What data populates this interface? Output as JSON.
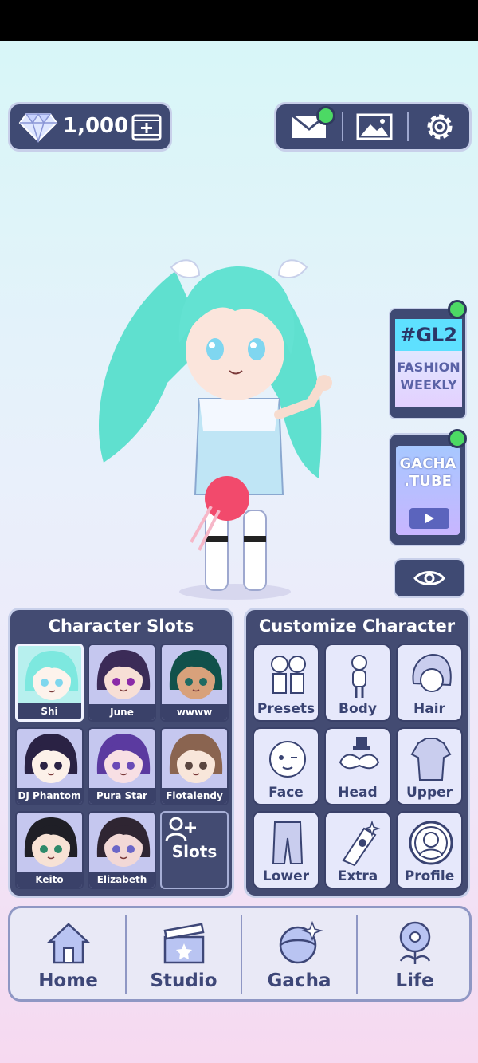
{
  "currency": {
    "amount": "1,000"
  },
  "promo": {
    "gl2_title": "#GL2",
    "gl2_line1": "FASHION",
    "gl2_line2": "WEEKLY",
    "tube_line1": "GACHA",
    "tube_line2": ".TUBE"
  },
  "slots_panel": {
    "title": "Character Slots",
    "slots": [
      {
        "name": "Shi",
        "hair": "#7de8df",
        "skin": "#fdf3ec",
        "eyes": "#7fd7ee"
      },
      {
        "name": "June",
        "hair": "#3b2b57",
        "skin": "#f7dfd6",
        "eyes": "#8a2aa8"
      },
      {
        "name": "wwww",
        "hair": "#11514b",
        "skin": "#d8a17b",
        "eyes": "#1f6a62"
      },
      {
        "name": "DJ Phantom",
        "hair": "#2a2244",
        "skin": "#fcf1e9",
        "eyes": "#2a2244"
      },
      {
        "name": "Pura Star",
        "hair": "#5b3aa0",
        "skin": "#f8dfe4",
        "eyes": "#6a4ab7"
      },
      {
        "name": "Flotalendy",
        "hair": "#8a6450",
        "skin": "#f8e6da",
        "eyes": "#5a4640"
      },
      {
        "name": "Keito",
        "hair": "#1f1f26",
        "skin": "#f7e2d5",
        "eyes": "#2d8a6a"
      },
      {
        "name": "Elizabeth",
        "hair": "#2f2532",
        "skin": "#f2d8d6",
        "eyes": "#6a66c8"
      }
    ],
    "add_label": "Slots"
  },
  "customize_panel": {
    "title": "Customize Character",
    "items": [
      {
        "label": "Presets",
        "icon": "presets-icon"
      },
      {
        "label": "Body",
        "icon": "body-icon"
      },
      {
        "label": "Hair",
        "icon": "hair-icon"
      },
      {
        "label": "Face",
        "icon": "face-icon"
      },
      {
        "label": "Head",
        "icon": "head-accessory-icon"
      },
      {
        "label": "Upper",
        "icon": "upper-clothing-icon"
      },
      {
        "label": "Lower",
        "icon": "lower-clothing-icon"
      },
      {
        "label": "Extra",
        "icon": "extra-icon"
      },
      {
        "label": "Profile",
        "icon": "profile-icon"
      }
    ]
  },
  "nav": {
    "items": [
      {
        "label": "Home",
        "icon": "home-icon"
      },
      {
        "label": "Studio",
        "icon": "clapperboard-icon"
      },
      {
        "label": "Gacha",
        "icon": "gacha-icon"
      },
      {
        "label": "Life",
        "icon": "flower-icon"
      }
    ]
  },
  "colors": {
    "panel_bg": "#434b72",
    "accent_green": "#4cd964",
    "nav_text": "#3e4778"
  }
}
